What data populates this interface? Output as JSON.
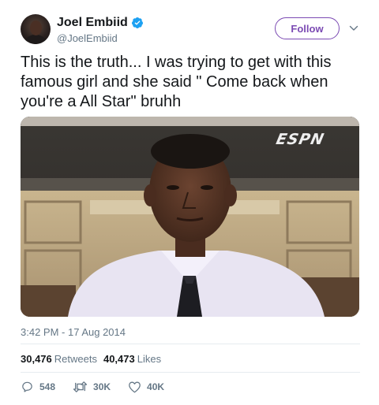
{
  "user": {
    "display_name": "Joel Embiid",
    "handle": "@JoelEmbiid",
    "verified": true
  },
  "follow_label": "Follow",
  "tweet": {
    "text": "This is the truth... I was trying to get with this famous girl and she said \" Come back when you're a All Star\" bruhh",
    "media": {
      "watermark": "ESPN"
    },
    "timestamp": "3:42 PM - 17 Aug 2014"
  },
  "stats": {
    "retweets_count": "30,476",
    "retweets_label": "Retweets",
    "likes_count": "40,473",
    "likes_label": "Likes"
  },
  "actions": {
    "replies": "548",
    "retweets": "30K",
    "likes": "40K"
  },
  "colors": {
    "accent": "#7b4ab3",
    "verified": "#1da1f2",
    "secondary_text": "#657786"
  }
}
